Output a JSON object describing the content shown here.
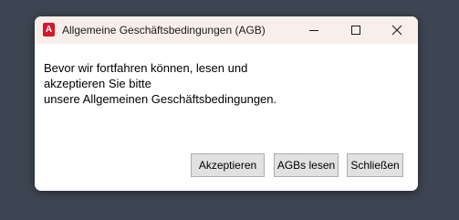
{
  "window": {
    "title": "Allgemeine Geschäftsbedingungen (AGB)",
    "app_icon": "autocad-a-icon",
    "app_icon_letter": "A",
    "controls": {
      "minimize": "minimize-icon",
      "maximize": "maximize-icon",
      "close": "close-icon"
    }
  },
  "message": {
    "lines": [
      "Bevor wir fortfahren können, lesen und",
      "akzeptieren Sie bitte",
      "unsere Allgemeinen Geschäftsbedingungen."
    ]
  },
  "buttons": {
    "accept": "Akzeptieren",
    "read": "AGBs lesen",
    "close": "Schließen"
  },
  "colors": {
    "desktop": "#3e4552",
    "titlebar": "#f8efeb",
    "app_icon": "#d7162a",
    "button_face": "#e1e1e1",
    "button_border": "#adadad"
  }
}
